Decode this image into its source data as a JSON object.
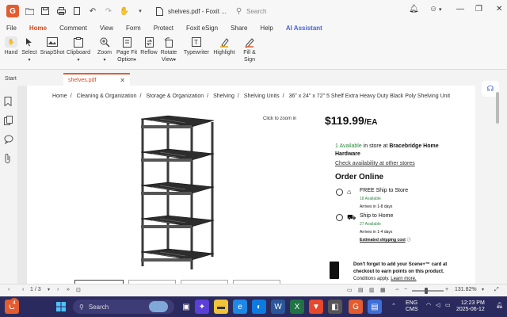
{
  "titlebar": {
    "title": "shelves.pdf - Foxit ...",
    "search_placeholder": "Search",
    "logo_glyph": "G"
  },
  "menu": {
    "tabs": [
      "File",
      "Home",
      "Comment",
      "View",
      "Form",
      "Protect",
      "Foxit eSign",
      "Share",
      "Help",
      "AI Assistant"
    ],
    "active_index": 1
  },
  "ribbon": {
    "hand": "Hand",
    "select": "Select",
    "snapshot": "SnapShot",
    "clipboard": "Clipboard",
    "zoom": "Zoom",
    "page_fit_1": "Page Fit",
    "page_fit_2": "Option",
    "reflow": "Reflow",
    "rotate_1": "Rotate",
    "rotate_2": "View",
    "typewriter": "Typewriter",
    "highlight": "Highlight",
    "fill_1": "Fill &",
    "fill_2": "Sign"
  },
  "tabs": {
    "start": "Start",
    "doc": "shelves.pdf"
  },
  "document": {
    "breadcrumb": [
      "Home",
      "Cleaning & Organization",
      "Storage & Organization",
      "Shelving",
      "Shelving Units",
      "36\" x 24\" x 72\" 5 Shelf Extra Heavy Duty Black Poly Shelving Unit"
    ],
    "zoom_hint": "Click to zoom in",
    "price": "$119.99",
    "price_unit": "/EA",
    "availability_count": "1 Available",
    "availability_text": " in store at ",
    "store_name": "Bracebridge Home Hardware",
    "check_link": "Check availability at other stores",
    "order_online": "Order Online",
    "options": [
      {
        "title": "FREE Ship to Store",
        "available": "18 Available",
        "arrival": "Arrives in 1-8 days",
        "extra": ""
      },
      {
        "title": "Ship to Home",
        "available": "27 Available",
        "arrival": "Arrives in 1-4 days",
        "extra": "Estimated shipping cost"
      }
    ],
    "scene_line1": "Don't forget to add your Scene+™ card at",
    "scene_line2": "checkout to earn points on this product.",
    "scene_line3a": "Conditions apply. ",
    "scene_line3b": "Learn more."
  },
  "statusbar": {
    "page": "1 / 3",
    "zoom": "131.82%"
  },
  "taskbar": {
    "search": "Search",
    "lang1": "ENG",
    "lang2": "CMS",
    "time": "12:23 PM",
    "date": "2025-06-12",
    "notify_count": "4"
  },
  "colors": {
    "accent": "#d64a1b",
    "taskbar": "#2b2a5e",
    "green": "#2d8a3e"
  }
}
